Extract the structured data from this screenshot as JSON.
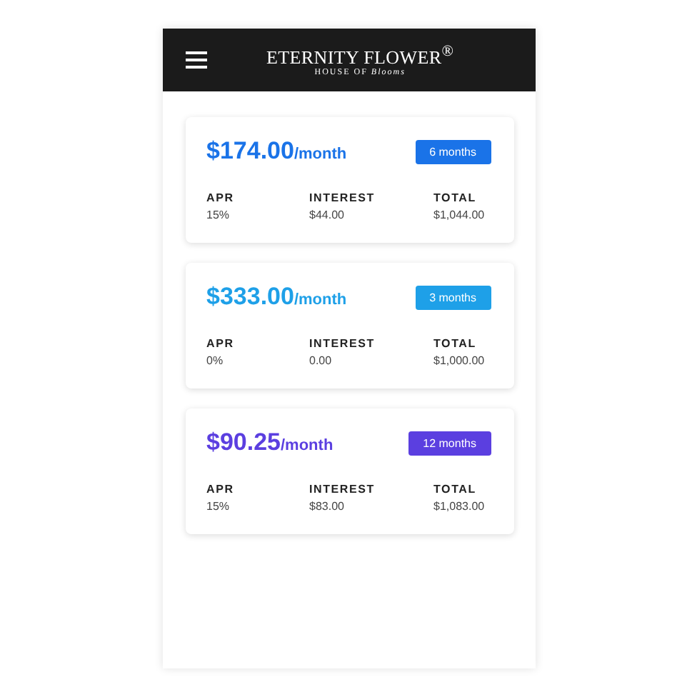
{
  "header": {
    "logo_title": "ETERNITY FLOWER$^{®}$",
    "logo_subtitle": "HOUSE OF *Blooms*"
  },
  "plans": [
    {
      "price": "$174.00",
      "unit": "/month",
      "term": "6 months",
      "color": "#1a73e8",
      "details": [
        {
          "label": "APR",
          "value": "15%"
        },
        {
          "label": "INTEREST",
          "value": "$44.00"
        },
        {
          "label": "TOTAL",
          "value": "$1,044.00"
        }
      ]
    },
    {
      "price": "$333.00",
      "unit": "/month",
      "term": "3 months",
      "color": "#1ea0e8",
      "details": [
        {
          "label": "APR",
          "value": "0%"
        },
        {
          "label": "INTEREST",
          "value": "0.00"
        },
        {
          "label": "TOTAL",
          "value": "$1,000.00"
        }
      ]
    },
    {
      "price": "$90.25",
      "unit": "/month",
      "term": "12 months",
      "color": "#5b3fe0",
      "details": [
        {
          "label": "APR",
          "value": "15%"
        },
        {
          "label": "INTEREST",
          "value": "$83.00"
        },
        {
          "label": "TOTAL",
          "value": "$1,083.00"
        }
      ]
    }
  ]
}
